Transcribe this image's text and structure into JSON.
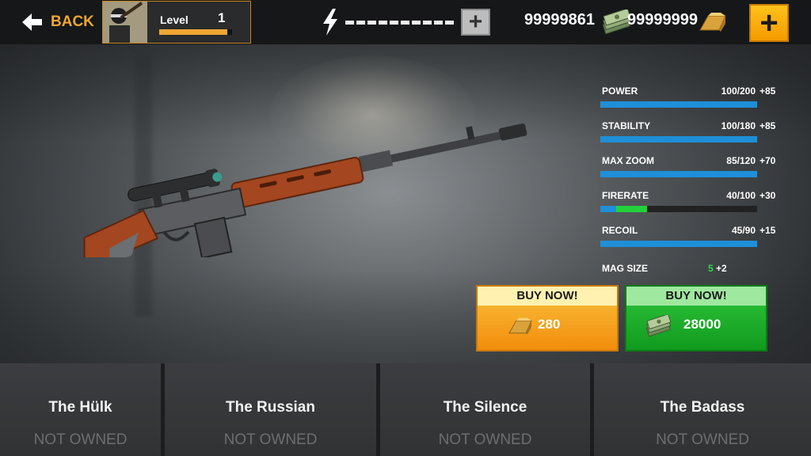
{
  "header": {
    "back_label": "BACK",
    "level_label": "Level",
    "level_value": "1",
    "level_progress": 0.94,
    "energy_segments": 10,
    "cash_amount": "99999861",
    "gold_amount": "99999999",
    "energy_plus_label": "+",
    "shop_plus_label": "+"
  },
  "stats": [
    {
      "name": "POWER",
      "value": "100/200",
      "bonus": "+85",
      "fill": 1.0
    },
    {
      "name": "STABILITY",
      "value": "100/180",
      "bonus": "+85",
      "fill": 1.0
    },
    {
      "name": "MAX ZOOM",
      "value": "85/120",
      "bonus": "+70",
      "fill": 1.0
    },
    {
      "name": "FIRERATE",
      "value": "40/100",
      "bonus": "+30",
      "fill": 0.1,
      "bonus_fill": 0.3
    },
    {
      "name": "RECOIL",
      "value": "45/90",
      "bonus": "+15",
      "fill": 1.0
    }
  ],
  "mag_size": {
    "name": "MAG SIZE",
    "value": "5",
    "bonus": "+2"
  },
  "buy": {
    "gold": {
      "head": "BUY NOW!",
      "price": "280",
      "icon": "gold-bar-icon"
    },
    "cash": {
      "head": "BUY NOW!",
      "price": "28000",
      "icon": "cash-stack-icon"
    }
  },
  "slots": [
    {
      "name": "The Hülk",
      "status": "NOT OWNED"
    },
    {
      "name": "The Russian",
      "status": "NOT OWNED"
    },
    {
      "name": "The Silence",
      "status": "NOT OWNED"
    },
    {
      "name": "The Badass",
      "status": "NOT OWNED"
    }
  ],
  "colors": {
    "accent_orange": "#f0a632",
    "stat_blue": "#1e8fd8",
    "bonus_green": "#22d23a",
    "gold_button": "#f28d0d",
    "cash_button": "#119a1e"
  }
}
